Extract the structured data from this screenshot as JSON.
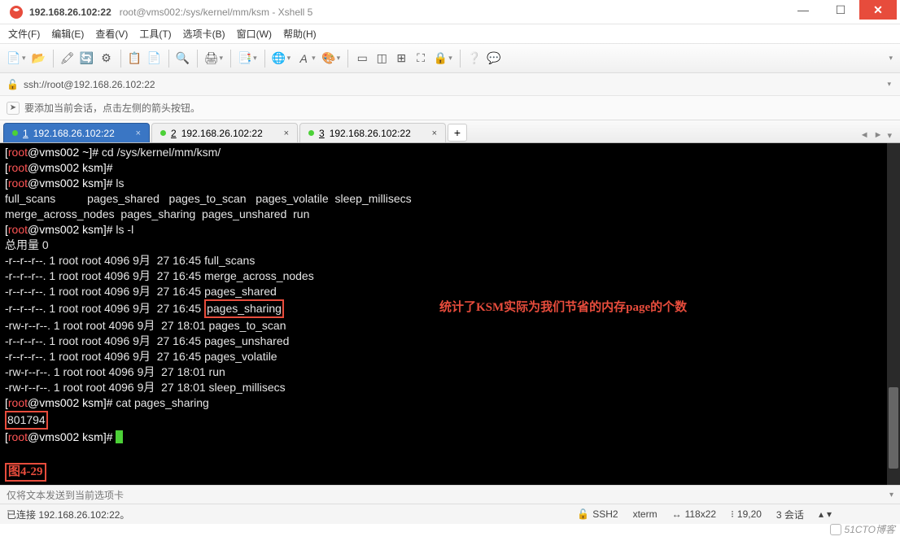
{
  "window": {
    "host": "192.168.26.102:22",
    "subtitle": "root@vms002:/sys/kernel/mm/ksm - Xshell 5"
  },
  "menu": {
    "file": "文件(F)",
    "edit": "编辑(E)",
    "view": "查看(V)",
    "tools": "工具(T)",
    "tabs": "选项卡(B)",
    "window": "窗口(W)",
    "help": "帮助(H)"
  },
  "addressbar": {
    "url": "ssh://root@192.168.26.102:22"
  },
  "infobar": {
    "hint": "要添加当前会话，点击左侧的箭头按钮。"
  },
  "tabs": [
    {
      "num": "1",
      "label": "192.168.26.102:22",
      "active": true
    },
    {
      "num": "2",
      "label": "192.168.26.102:22",
      "active": false
    },
    {
      "num": "3",
      "label": "192.168.26.102:22",
      "active": false
    }
  ],
  "terminal": {
    "user": "root",
    "host": "vms002",
    "home_path": "~",
    "ksm_path": "ksm",
    "cmd_cd": "cd /sys/kernel/mm/ksm/",
    "cmd_ls": "ls",
    "cmd_lsl": "ls -l",
    "cmd_cat": "cat pages_sharing",
    "ls_out_line1": "full_scans          pages_shared   pages_to_scan   pages_volatile  sleep_millisecs",
    "ls_out_line2": "merge_across_nodes  pages_sharing  pages_unshared  run",
    "total": "总用量 0",
    "files": [
      {
        "perm": "-r--r--r--.",
        "links": "1",
        "owner": "root",
        "group": "root",
        "size": "4096",
        "month": "9月",
        "day": "27",
        "time": "16:45",
        "name": "full_scans"
      },
      {
        "perm": "-r--r--r--.",
        "links": "1",
        "owner": "root",
        "group": "root",
        "size": "4096",
        "month": "9月",
        "day": "27",
        "time": "16:45",
        "name": "merge_across_nodes"
      },
      {
        "perm": "-r--r--r--.",
        "links": "1",
        "owner": "root",
        "group": "root",
        "size": "4096",
        "month": "9月",
        "day": "27",
        "time": "16:45",
        "name": "pages_shared"
      },
      {
        "perm": "-r--r--r--.",
        "links": "1",
        "owner": "root",
        "group": "root",
        "size": "4096",
        "month": "9月",
        "day": "27",
        "time": "16:45",
        "name": "pages_sharing",
        "boxed": true
      },
      {
        "perm": "-rw-r--r--.",
        "links": "1",
        "owner": "root",
        "group": "root",
        "size": "4096",
        "month": "9月",
        "day": "27",
        "time": "18:01",
        "name": "pages_to_scan"
      },
      {
        "perm": "-r--r--r--.",
        "links": "1",
        "owner": "root",
        "group": "root",
        "size": "4096",
        "month": "9月",
        "day": "27",
        "time": "16:45",
        "name": "pages_unshared"
      },
      {
        "perm": "-r--r--r--.",
        "links": "1",
        "owner": "root",
        "group": "root",
        "size": "4096",
        "month": "9月",
        "day": "27",
        "time": "16:45",
        "name": "pages_volatile"
      },
      {
        "perm": "-rw-r--r--.",
        "links": "1",
        "owner": "root",
        "group": "root",
        "size": "4096",
        "month": "9月",
        "day": "27",
        "time": "18:01",
        "name": "run"
      },
      {
        "perm": "-rw-r--r--.",
        "links": "1",
        "owner": "root",
        "group": "root",
        "size": "4096",
        "month": "9月",
        "day": "27",
        "time": "18:01",
        "name": "sleep_millisecs"
      }
    ],
    "cat_result": "801794",
    "annotation": "统计了KSM实际为我们节省的内存page的个数",
    "fig_label": "图4-29"
  },
  "sendbar": {
    "text": "仅将文本发送到当前选项卡"
  },
  "statusbar": {
    "conn": "已连接 192.168.26.102:22。",
    "proto": "SSH2",
    "term": "xterm",
    "size": "118x22",
    "pos": "19,20",
    "sessions": "3 会话"
  },
  "watermark": "51CTO博客"
}
